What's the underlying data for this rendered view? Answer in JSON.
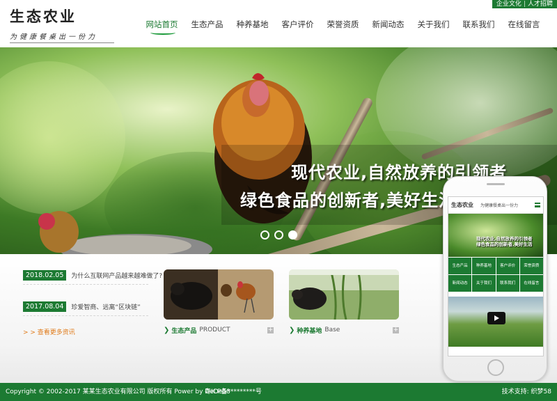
{
  "top_links": [
    "企业文化",
    "人才招聘"
  ],
  "logo": {
    "title": "生态农业",
    "slogan": "为健康餐桌出一份力"
  },
  "nav": [
    {
      "label": "网站首页",
      "active": true
    },
    {
      "label": "生态产品"
    },
    {
      "label": "种养基地"
    },
    {
      "label": "客户评价"
    },
    {
      "label": "荣誉资质"
    },
    {
      "label": "新闻动态"
    },
    {
      "label": "关于我们"
    },
    {
      "label": "联系我们"
    },
    {
      "label": "在线留言"
    }
  ],
  "banner": {
    "line1": "现代农业,自然放养的引领者",
    "line2": "绿色食品的创新者,美好生活",
    "slide_count": 3,
    "active_slide": 3
  },
  "news": {
    "items": [
      {
        "date": "2018.02.05",
        "title": "为什么互联网产品越来越难做了?"
      },
      {
        "date": "2017.08.04",
        "title": "珍爱智商、远离“区块链”"
      }
    ],
    "more": "> > 查看更多资讯"
  },
  "cards": [
    {
      "cn": "生态产品",
      "en": "PRODUCT",
      "plus": "+"
    },
    {
      "cn": "种养基地",
      "en": "Base",
      "plus": "+"
    }
  ],
  "mobile": {
    "logo": "生态农业",
    "slogan": "为健康餐桌出一份力",
    "banner_line1": "现代农业,自然放养的引领者",
    "banner_line2": "绿色食品的创新者,美好生活",
    "nav": [
      "生态产品",
      "种养基地",
      "客户评价",
      "荣誉资质",
      "新闻动态",
      "关于我们",
      "联系我们",
      "在线留言"
    ]
  },
  "footer": {
    "copyright": "Copyright © 2002-2017 某某生态农业有限公司 版权所有 Power by DeDe58",
    "icp": "粤ICP备*********号",
    "tech": "技术支持: 织梦58"
  },
  "colors": {
    "brand": "#1c7a32",
    "accent": "#e07b1a"
  }
}
